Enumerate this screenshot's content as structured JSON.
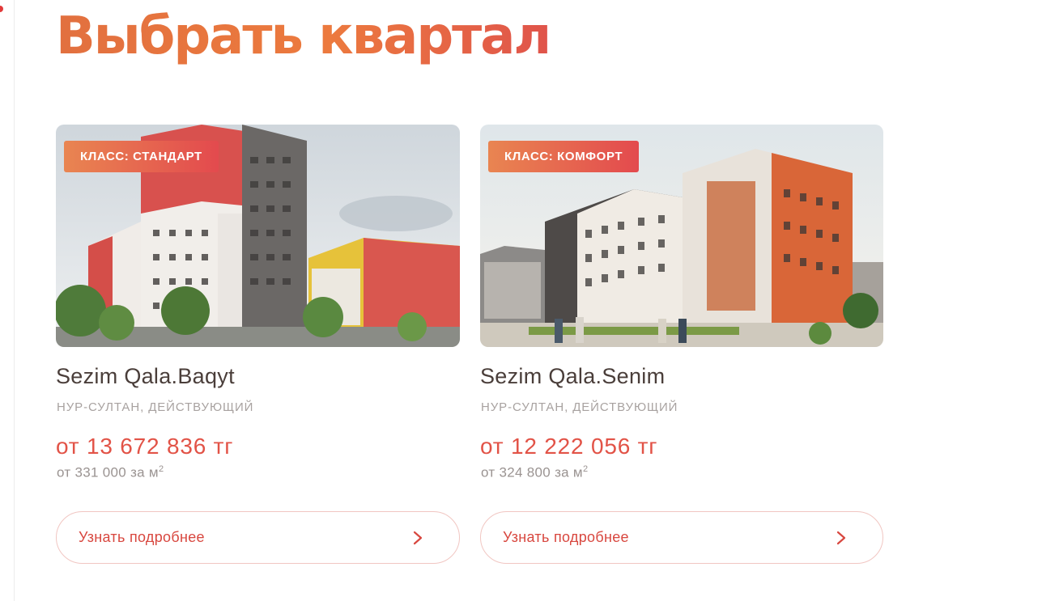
{
  "page": {
    "title": "Выбрать квартал"
  },
  "projects": [
    {
      "class_badge": "КЛАСС: СТАНДАРТ",
      "name": "Sezim Qala.Baqyt",
      "location": "НУР-СУЛТАН, ДЕЙСТВУЮЩИЙ",
      "price": "от 13 672 836 тг",
      "price_per_m": "от 331 000 за м",
      "unit_sup": "2",
      "button_label": "Узнать подробнее",
      "button_icon": "chevron-right-icon"
    },
    {
      "class_badge": "КЛАСС: КОМФОРТ",
      "name": "Sezim Qala.Senim",
      "location": "НУР-СУЛТАН, ДЕЙСТВУЮЩИЙ",
      "price": "от 12 222 056 тг",
      "price_per_m": "от 324 800 за м",
      "unit_sup": "2",
      "button_label": "Узнать подробнее",
      "button_icon": "chevron-right-icon"
    }
  ],
  "colors": {
    "accent": "#e25347",
    "title_gradient_start": "#e2703f",
    "title_gradient_end": "#e0544b",
    "text_dark": "#4a3e3a",
    "text_muted": "#a8a2a0"
  }
}
